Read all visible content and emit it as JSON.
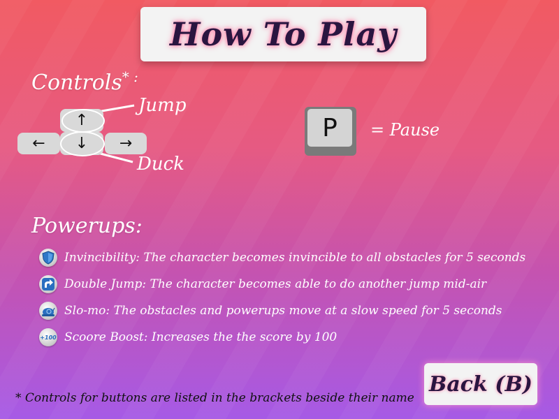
{
  "title": "How To Play",
  "controls": {
    "heading": "Controls",
    "heading_mark": "* :",
    "keys": {
      "up": "↑",
      "down": "↓",
      "left": "←",
      "right": "→"
    },
    "jump_label": "Jump",
    "duck_label": "Duck"
  },
  "pause": {
    "key": "P",
    "label": "= Pause"
  },
  "powerups": {
    "heading": "Powerups:",
    "items": [
      {
        "icon": "shield-icon",
        "text": "Invincibility: The character becomes invincible to all obstacles for 5 seconds"
      },
      {
        "icon": "double-jump-arrow-icon",
        "text": "Double Jump: The character becomes able to do another jump mid-air"
      },
      {
        "icon": "snail-icon",
        "text": "Slo-mo: The obstacles and powerups move at a slow speed for 5 seconds"
      },
      {
        "icon": "plus-100-icon",
        "icon_text": "+100",
        "text": "Scoore Boost: Increases the the score by 100"
      }
    ]
  },
  "back_button": "Back (B)",
  "footnote": "* Controls for buttons are listed in the brackets beside their name",
  "colors": {
    "title_text": "#2a1540",
    "glow": "#ff7aa8",
    "panel": "#f3f3f3",
    "key": "#d9d9d9",
    "bg_top": "#f15a62",
    "bg_bottom": "#a65ae6"
  }
}
